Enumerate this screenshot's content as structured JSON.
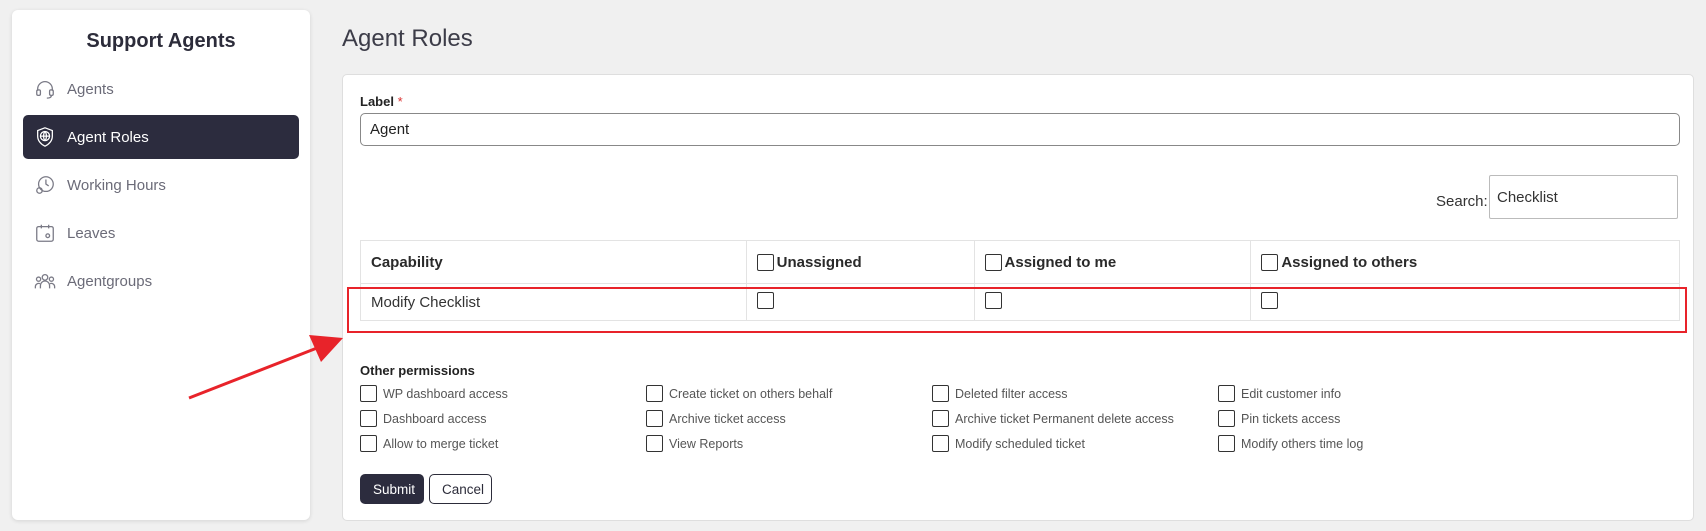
{
  "sidebar": {
    "title": "Support Agents",
    "items": [
      {
        "label": "Agents",
        "icon": "headset-icon",
        "active": false
      },
      {
        "label": "Agent Roles",
        "icon": "shield-globe-icon",
        "active": true
      },
      {
        "label": "Working Hours",
        "icon": "clock-icon",
        "active": false
      },
      {
        "label": "Leaves",
        "icon": "calendar-icon",
        "active": false
      },
      {
        "label": "Agentgroups",
        "icon": "group-icon",
        "active": false
      }
    ]
  },
  "page": {
    "title": "Agent Roles"
  },
  "form": {
    "label_title": "Label",
    "required_mark": "*",
    "label_value": "Agent",
    "search_label": "Search:",
    "search_value": "Checklist"
  },
  "table": {
    "headers": [
      "Capability",
      "Unassigned",
      "Assigned to me",
      "Assigned to others"
    ],
    "rows": [
      {
        "capability": "Modify Checklist"
      }
    ]
  },
  "other_permissions": {
    "title": "Other permissions",
    "items": [
      "WP dashboard access",
      "Create ticket on others behalf",
      "Deleted filter access",
      "Edit customer info",
      "Dashboard access",
      "Archive ticket access",
      "Archive ticket Permanent delete access",
      "Pin tickets access",
      "Allow to merge ticket",
      "View Reports",
      "Modify scheduled ticket",
      "Modify others time log"
    ]
  },
  "buttons": {
    "submit": "Submit",
    "cancel": "Cancel"
  },
  "colors": {
    "accent": "#2c2c3e",
    "highlight": "#e8232a"
  }
}
